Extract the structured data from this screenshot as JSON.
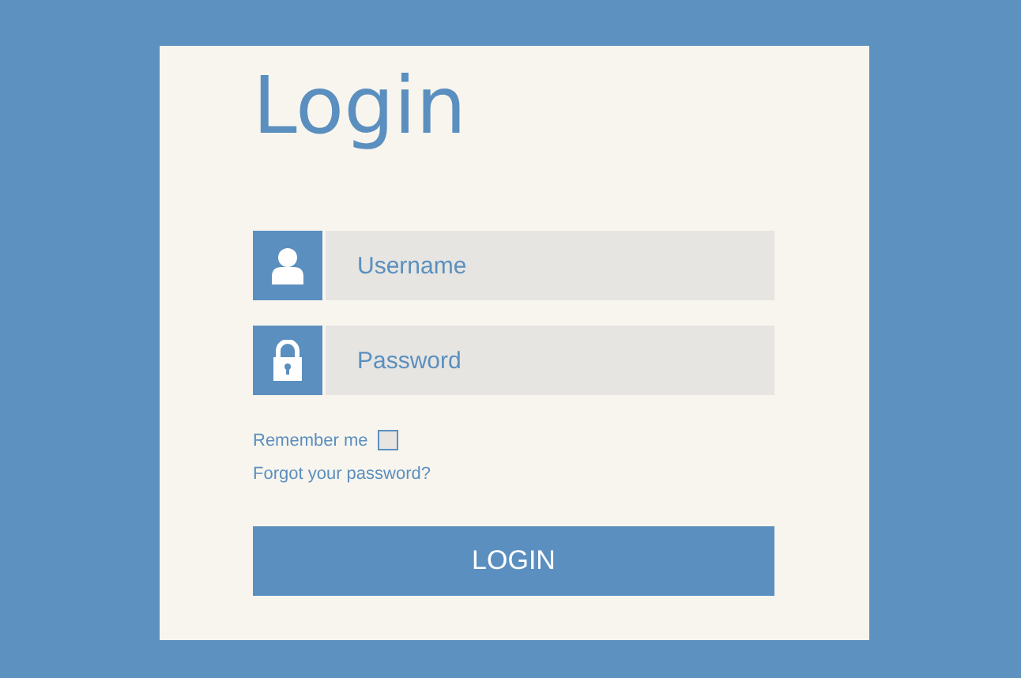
{
  "title": "Login",
  "fields": [
    {
      "kind": "user",
      "placeholder": "Username"
    },
    {
      "kind": "lock",
      "placeholder": "Password"
    }
  ],
  "remember": {
    "label": "Remember me",
    "checked": false
  },
  "forgot_link": "Forgot your password?",
  "button": "LOGIN"
}
